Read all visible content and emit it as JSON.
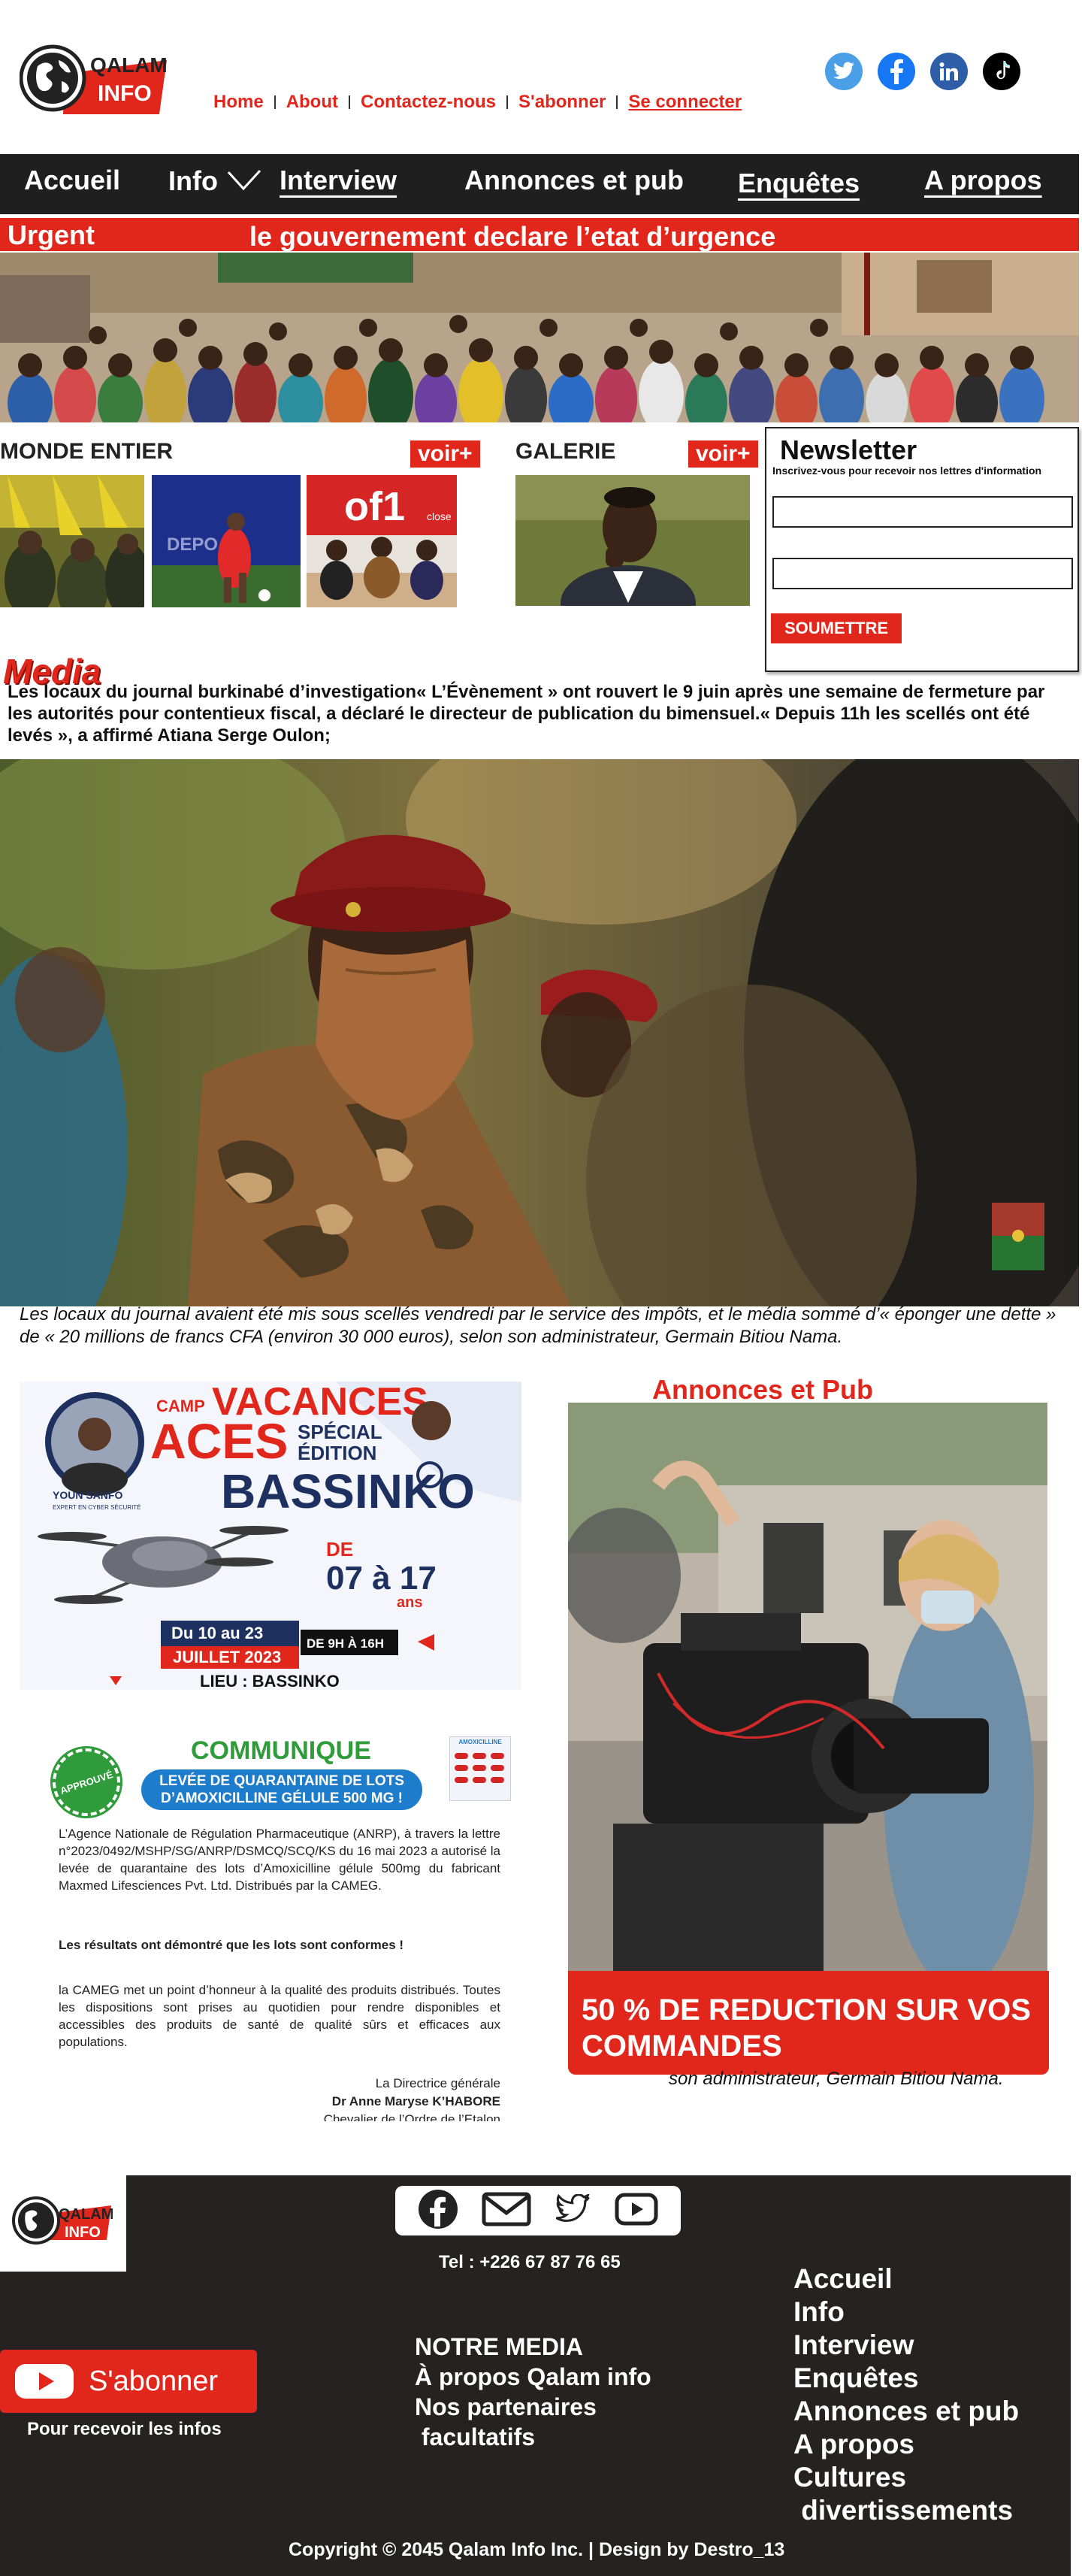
{
  "brand": {
    "name_top": "QALAM",
    "name_bottom": "INFO"
  },
  "top_links": [
    {
      "label": "Home",
      "underline": false
    },
    {
      "label": "About",
      "underline": false
    },
    {
      "label": "Contactez-nous",
      "underline": false
    },
    {
      "label": "S'abonner",
      "underline": false
    },
    {
      "label": "Se connecter",
      "underline": true
    }
  ],
  "social": [
    {
      "icon": "twitter-icon",
      "color": "#4a9fe6"
    },
    {
      "icon": "facebook-icon",
      "color": "#1877f2"
    },
    {
      "icon": "linkedin-icon",
      "color": "#2f5ea8"
    },
    {
      "icon": "tiktok-icon",
      "color": "#000000"
    }
  ],
  "nav": {
    "accueil": "Accueil",
    "info": "Info",
    "interview": "Interview",
    "annonces": "Annonces et pub",
    "enquetes": "Enquêtes",
    "apropos": "A propos"
  },
  "urgent": {
    "label": "Urgent",
    "headline": "le gouvernement declare l’etat d’urgence"
  },
  "sections": {
    "monde": {
      "title": "MONDE ENTIER",
      "more": "voir+"
    },
    "galerie": {
      "title": "GALERIE",
      "more": "voir+"
    }
  },
  "newsletter": {
    "title": "Newsletter",
    "subtitle": "Inscrivez-vous pour recevoir nos lettres d'information",
    "button": "SOUMETTRE"
  },
  "media": {
    "title": "Media",
    "lead": "Les locaux du journal burkinabé d’investigation« L’Évènement » ont rouvert le 9 juin après une semaine de fermeture par les autorités pour contentieux fiscal, a déclaré le directeur de publication du bimensuel.« Depuis 11h les scellés ont été levés », a affirmé Atiana Serge Oulon;",
    "caption": "Les locaux du journal avaient été mis sous scellés vendredi par le service des impôts, et le média sommé d’« éponger une dette » de « 20 millions de francs CFA (environ 30 000 euros), selon son administrateur, Germain Bitiou Nama."
  },
  "poster1": {
    "camp": "CAMP",
    "vacances": "VACANCES",
    "aces": "ACES",
    "special": "SPÉCIAL",
    "edition": "ÉDITION",
    "bassinko": "BASSINKO",
    "de": "DE",
    "ages": "07 à 17",
    "ans": "ans",
    "dates_line1": "Du 10 au 23",
    "dates_line2": "JUILLET 2023",
    "hours": "DE 9H À 16H",
    "lieu": "LIEU : BASSINKO",
    "person_name": "YOUN SANFO",
    "person_title": "EXPERT EN CYBER SÉCURITÉ"
  },
  "poster2": {
    "stamp": "APPROUVÉ",
    "title": "COMMUNIQUE",
    "banner_line1": "LEVÉE DE QUARANTAINE DE LOTS",
    "banner_line2": "D’AMOXICILLINE GÉLULE 500 MG !",
    "p1": "L’Agence Nationale de Régulation Pharmaceutique (ANRP), à travers la lettre n°2023/0492/MSHP/SG/ANRP/DSMCQ/SCQ/KS du 16 mai 2023 a autorisé la levée de quarantaine des lots d’Amoxicilline gélule 500mg du fabricant Maxmed Lifesciences Pvt. Ltd. Distribués par la CAMEG.",
    "p2": "Les résultats ont démontré que les lots sont conformes !",
    "p3": "la CAMEG met un point d’honneur à la qualité des produits distribués. Toutes les dispositions sont prises au quotidien pour rendre disponibles et accessibles des produits de santé de qualité sûrs et efficaces aux populations.",
    "sign_role": "La Directrice générale",
    "sign_name": "Dr Anne Maryse K’HABORE",
    "sign_extra": "Chevalier de l’Ordre de l’Etalon",
    "box_label": "AMOXICILLINE"
  },
  "annonces": {
    "title": "Annonces et Pub",
    "promo": "50 % DE REDUCTION SUR VOS COMMANDES",
    "caption": "son administrateur, Germain Bitiou Nama."
  },
  "footer": {
    "tel": "Tel : +226 67 87 76 65",
    "subscribe": "S'abonner",
    "subscribe_note": "Pour recevoir les infos",
    "media_title": "NOTRE MEDIA",
    "media_links": [
      "À propos Qalam info",
      "Nos partenaires",
      " facultatifs"
    ],
    "nav": [
      "Accueil",
      "Info",
      "Interview",
      "Enquêtes",
      "Annonces et pub",
      "A propos",
      "Cultures",
      " divertissements"
    ],
    "copyright": "Copyright © 2045 Qalam Info Inc. | Design by Destro_13",
    "icons": [
      "facebook-icon",
      "mail-icon",
      "twitter-icon",
      "youtube-icon"
    ]
  }
}
